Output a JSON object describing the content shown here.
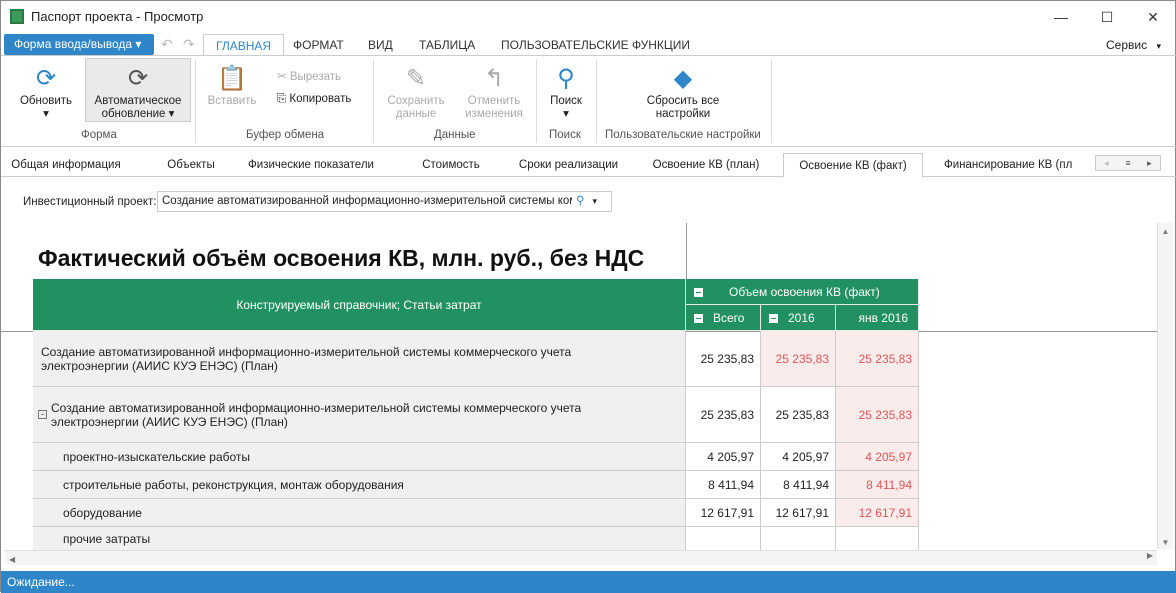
{
  "window": {
    "title": "Паспорт проекта - Просмотр",
    "minimize": "—",
    "maximize": "☐",
    "close": "✕"
  },
  "ribbon": {
    "form_menu": "Форма ввода/вывода",
    "tabs": [
      "ГЛАВНАЯ",
      "ФОРМАТ",
      "ВИД",
      "ТАБЛИЦА",
      "ПОЛЬЗОВАТЕЛЬСКИЕ ФУНКЦИИ"
    ],
    "service": "Сервис",
    "buttons": {
      "refresh": "Обновить",
      "auto1": "Автоматическое",
      "auto2": "обновление",
      "paste": "Вставить",
      "cut": "Вырезать",
      "copy": "Копировать",
      "save1": "Сохранить",
      "save2": "данные",
      "cancel1": "Отменить",
      "cancel2": "изменения",
      "search": "Поиск",
      "reset1": "Сбросить все",
      "reset2": "настройки"
    },
    "groups": [
      "Форма",
      "Буфер обмена",
      "Данные",
      "Поиск",
      "Пользовательские настройки"
    ]
  },
  "doc_tabs": [
    "Общая информация",
    "Объекты",
    "Физические показатели",
    "Стоимость",
    "Сроки реализации",
    "Освоение КВ (план)",
    "Освоение КВ (факт)",
    "Финансирование КВ (пл"
  ],
  "filter": {
    "label": "Инвестиционный проект:",
    "value": "Создание автоматизированной информационно-измерительной системы коммерч"
  },
  "report": {
    "title": "Фактический объём освоения КВ, млн. руб., без НДС",
    "row_header": "Конструируемый справочник; Статьи затрат",
    "group_header": "Объем освоения КВ (факт)",
    "columns": [
      "Всего",
      "2016",
      "янв 2016"
    ],
    "rows": [
      {
        "label": "Создание автоматизированной информационно-измерительной системы коммерческого учета электроэнергии (АИИС КУЭ ЕНЭС) (План)",
        "values": [
          "25 235,83",
          "25 235,83",
          "25 235,83"
        ]
      },
      {
        "label": "Создание автоматизированной информационно-измерительной системы коммерческого учета электроэнергии (АИИС КУЭ ЕНЭС) (План)",
        "values": [
          "25 235,83",
          "25 235,83",
          "25 235,83"
        ]
      },
      {
        "label": "проектно-изыскательские работы",
        "values": [
          "4 205,97",
          "4 205,97",
          "4 205,97"
        ]
      },
      {
        "label": "строительные работы, реконструкция, монтаж оборудования",
        "values": [
          "8 411,94",
          "8 411,94",
          "8 411,94"
        ]
      },
      {
        "label": "оборудование",
        "values": [
          "12 617,91",
          "12 617,91",
          "12 617,91"
        ]
      },
      {
        "label": "прочие затраты",
        "values": [
          "",
          "",
          ""
        ]
      }
    ]
  },
  "status": "Ожидание..."
}
